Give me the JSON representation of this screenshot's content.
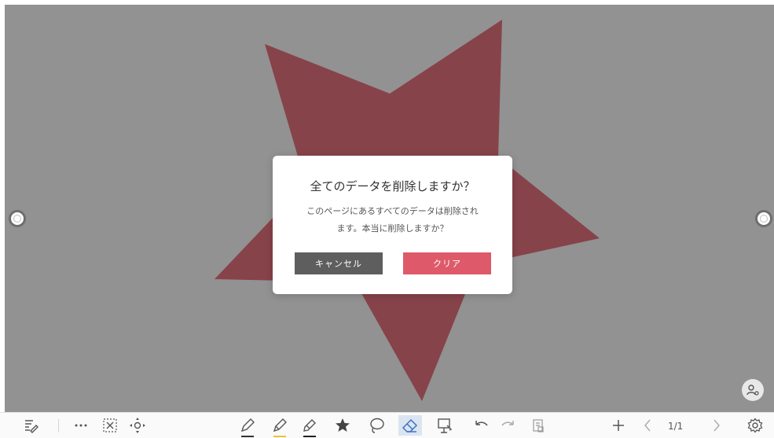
{
  "dialog": {
    "title": "全てのデータを削除しますか？",
    "message_line1": "このページにあるすべてのデータは削除され",
    "message_line2": "ます。本当に削除しますか？",
    "cancel_label": "キャンセル",
    "clear_label": "クリア"
  },
  "canvas": {
    "background_color": "#929292",
    "star_color": "#87434a"
  },
  "toolbar": {
    "page_indicator": "1/1",
    "icons": [
      "notes-icon",
      "more-icon",
      "select-icon",
      "move-icon",
      "pencil-icon",
      "highlighter-icon",
      "marker-icon",
      "star-icon",
      "lasso-icon",
      "eraser-icon",
      "insert-icon",
      "undo-icon",
      "redo-icon",
      "clipboard-icon",
      "add-page-icon",
      "prev-page-icon",
      "next-page-icon",
      "settings-icon"
    ],
    "active_tool": "eraser-icon",
    "pen_colors": {
      "pencil": "#333333",
      "highlighter": "#f1c232",
      "marker": "#222222"
    }
  },
  "colors": {
    "cancel": "#5e5e5e",
    "clear": "#de5a6a"
  }
}
